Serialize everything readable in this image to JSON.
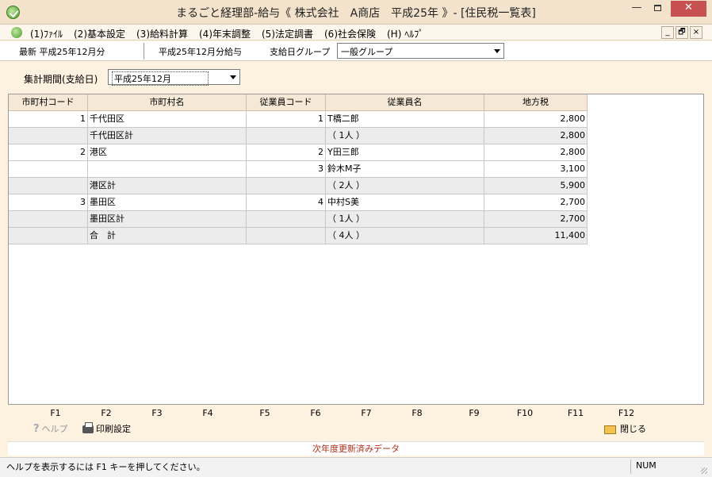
{
  "window": {
    "title": "まるごと経理部-給与《 株式会社　A商店　平成25年 》- [住民税一覧表]"
  },
  "menu": {
    "items": [
      "(1)ﾌｧｲﾙ",
      "(2)基本設定",
      "(3)給料計算",
      "(4)年末調整",
      "(5)法定調書",
      "(6)社会保険",
      "(H) ﾍﾙﾌﾟ"
    ],
    "mdi_min": "_",
    "mdi_restore": "🗗",
    "mdi_close": "×"
  },
  "infobar": {
    "latest": "最新 平成25年12月分",
    "current": "平成25年12月分給与",
    "group_label": "支給日グループ",
    "group_value": "一般グループ"
  },
  "period": {
    "label": "集計期間(支給日)",
    "value": "平成25年12月"
  },
  "table": {
    "headers": [
      "市町村コード",
      "市町村名",
      "従業員コード",
      "従業員名",
      "地方税"
    ],
    "rows": [
      {
        "city_code": "1",
        "city": "千代田区",
        "emp_code": "1",
        "emp": "T橋二郎",
        "tax": "2,800"
      },
      {
        "city_code": "",
        "city": "千代田区計",
        "emp_code": "",
        "emp": "（ 1人 ）",
        "tax": "2,800"
      },
      {
        "city_code": "2",
        "city": "港区",
        "emp_code": "2",
        "emp": "Y田三郎",
        "tax": "2,800"
      },
      {
        "city_code": "",
        "city": "",
        "emp_code": "3",
        "emp": "鈴木M子",
        "tax": "3,100"
      },
      {
        "city_code": "",
        "city": "港区計",
        "emp_code": "",
        "emp": "（ 2人 ）",
        "tax": "5,900"
      },
      {
        "city_code": "3",
        "city": "墨田区",
        "emp_code": "4",
        "emp": "中村S美",
        "tax": "2,700"
      },
      {
        "city_code": "",
        "city": "墨田区計",
        "emp_code": "",
        "emp": "（ 1人 ）",
        "tax": "2,700"
      },
      {
        "city_code": "",
        "city": "合　計",
        "emp_code": "",
        "emp": "（ 4人 ）",
        "tax": "11,400"
      }
    ]
  },
  "fkeys": [
    "F1",
    "F2",
    "F3",
    "F4",
    "F5",
    "F6",
    "F7",
    "F8",
    "F9",
    "F10",
    "F11",
    "F12"
  ],
  "actions": {
    "help": "ヘルプ",
    "print": "印刷設定",
    "close": "閉じる"
  },
  "notice": "次年度更新済みデータ",
  "status": {
    "message": "ヘルプを表示するには F1 キーを押してください。",
    "num": "NUM"
  }
}
